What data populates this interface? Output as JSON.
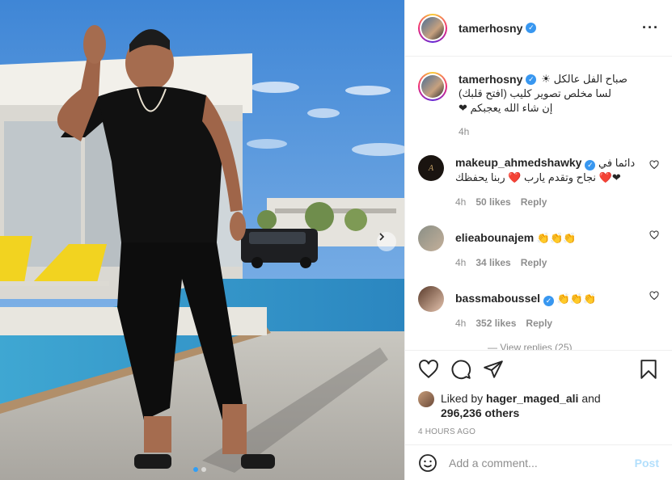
{
  "post": {
    "username": "tamerhosny",
    "verified": true,
    "more_icon": "more-options-icon"
  },
  "caption": {
    "username": "tamerhosny",
    "lines": [
      "صباح الفل عالكل ☀",
      "لسا مخلص تصوير كليب (افتح قلبك)",
      "إن شاء الله يعجبكم ❤"
    ],
    "time": "4h"
  },
  "comments": [
    {
      "username": "makeup_ahmedshawky",
      "verified": true,
      "text_line1": "دائما في",
      "text_line2": "❤❤️ نجاح وتقدم يارب ❤️ ربنا يحفظك",
      "time": "4h",
      "likes": "50 likes",
      "reply": "Reply"
    },
    {
      "username": "elieabounajem",
      "verified": false,
      "text": "👏👏👏",
      "time": "4h",
      "likes": "34 likes",
      "reply": "Reply"
    },
    {
      "username": "bassmaboussel",
      "verified": true,
      "text": "👏👏👏",
      "time": "4h",
      "likes": "352 likes",
      "reply": "Reply"
    }
  ],
  "load_more": "— View replies (25)",
  "likes": {
    "prefix": "Liked by",
    "user": "hager_maged_ali",
    "and": "and",
    "others": "296,236 others"
  },
  "timestamp": "4 HOURS AGO",
  "add_comment": {
    "placeholder": "Add a comment...",
    "post_label": "Post"
  },
  "carousel": {
    "slides": 2,
    "active": 1
  },
  "colors": {
    "verified": "#3897f0",
    "muted": "#8e8e8e",
    "post_disabled": "#b2dffc",
    "active_dot": "#2f9ef7"
  }
}
